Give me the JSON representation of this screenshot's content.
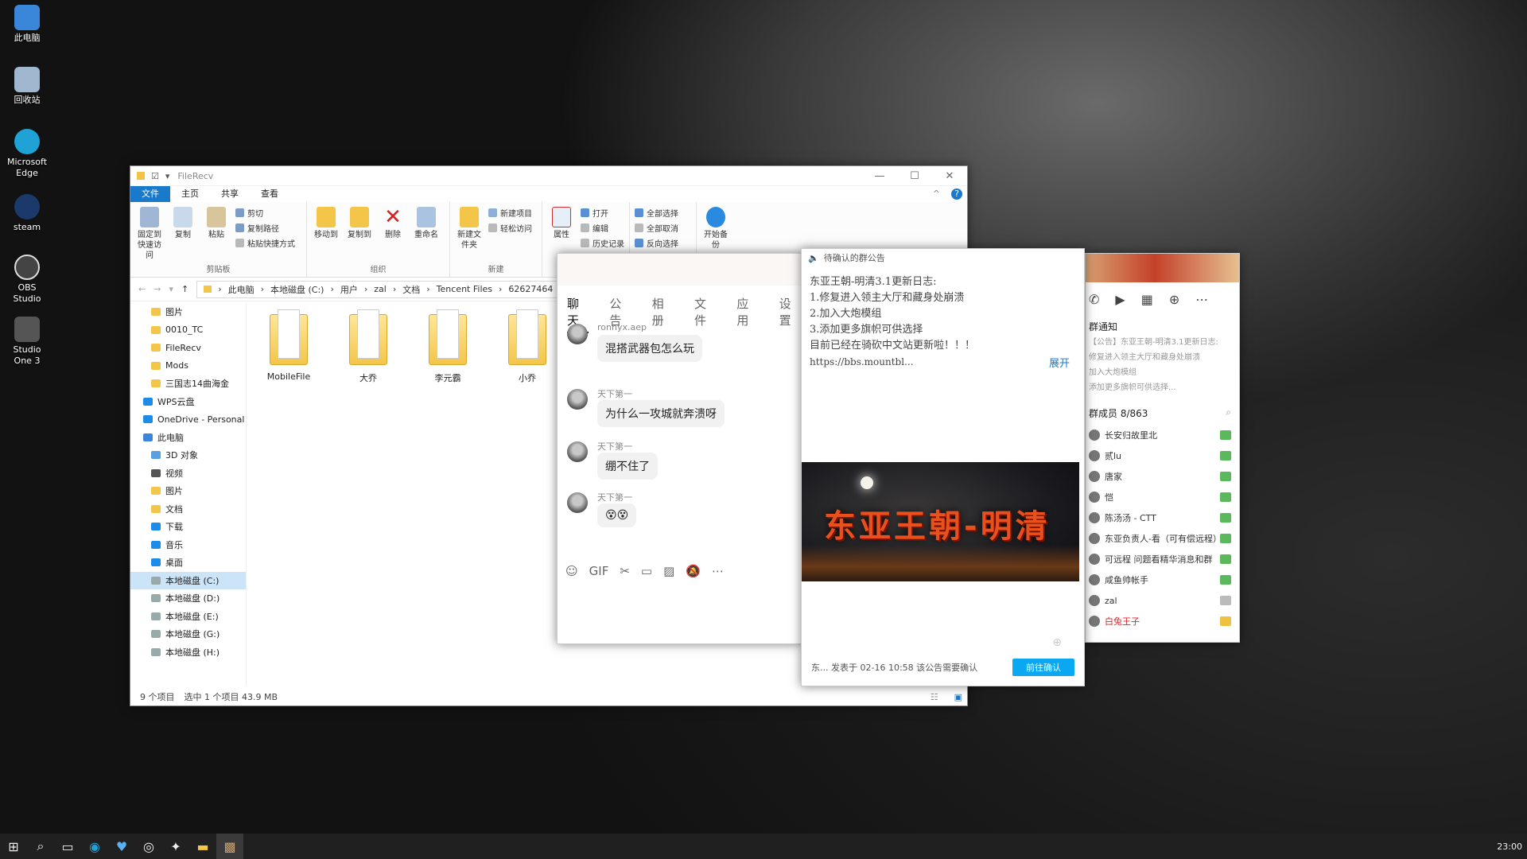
{
  "desktop": {
    "icons": [
      {
        "label": "此电脑",
        "color": "#3a86d8"
      },
      {
        "label": "回收站",
        "color": "#9fb8d0"
      },
      {
        "label": "Microsoft Edge",
        "color": "#1fa3d6"
      },
      {
        "label": "steam",
        "color": "#1b3a6b"
      },
      {
        "label": "OBS Studio",
        "color": "#444444"
      },
      {
        "label": "Studio One 3",
        "color": "#555555"
      }
    ]
  },
  "explorer": {
    "title": "FileRecv",
    "tabs": [
      "文件",
      "主页",
      "共享",
      "查看"
    ],
    "ribbon": {
      "clipboard": {
        "name": "剪贴板",
        "pin": "固定到快速访问",
        "copy": "复制",
        "paste": "粘贴",
        "cut": "剪切",
        "copy_path": "复制路径",
        "paste_shortcut": "粘贴快捷方式"
      },
      "organize": {
        "name": "组织",
        "move_to": "移动到",
        "copy_to": "复制到",
        "delete": "删除",
        "rename": "重命名"
      },
      "new": {
        "name": "新建",
        "new_folder": "新建文件夹",
        "new_item": "新建项目",
        "easy_access": "轻松访问"
      },
      "open": {
        "properties": "属性",
        "open": "打开",
        "edit": "编辑",
        "history": "历史记录"
      },
      "select": {
        "all": "全部选择",
        "none": "全部取消",
        "invert": "反向选择"
      },
      "sync": "开始备份"
    },
    "breadcrumbs": [
      "此电脑",
      "本地磁盘 (C:)",
      "用户",
      "zal",
      "文档",
      "Tencent Files",
      "62627464"
    ],
    "nav": [
      "图片",
      "0010_TC",
      "FileRecv",
      "Mods",
      "三国志14曲海金",
      "WPS云盘",
      "OneDrive - Personal",
      "此电脑",
      "3D 对象",
      "视频",
      "图片",
      "文档",
      "下载",
      "音乐",
      "桌面",
      "本地磁盘 (C:)",
      "本地磁盘 (D:)",
      "本地磁盘 (E:)",
      "本地磁盘 (G:)",
      "本地磁盘 (H:)"
    ],
    "files": [
      "MobileFile",
      "大乔",
      "李元霸",
      "小乔"
    ],
    "status": {
      "count": "9 个项目",
      "selected": "选中 1 个项目  43.9 MB"
    }
  },
  "chat": {
    "tabs": [
      "聊天",
      "公告",
      "相册",
      "文件",
      "应用",
      "设置"
    ],
    "messages": [
      {
        "name": "ronnyx.aep",
        "text": "混搭武器包怎么玩"
      },
      {
        "name": "天下第一",
        "text": "为什么一攻城就奔溃呀"
      },
      {
        "name": "天下第一",
        "text": "绷不住了"
      },
      {
        "name": "天下第一",
        "text": "😵😵"
      }
    ],
    "tools": [
      "☺",
      "GIF",
      "✂",
      "▭",
      "▨",
      "🔕",
      "⋯"
    ]
  },
  "notice": {
    "header": "待确认的群公告",
    "lines": [
      "东亚王朝-明清3.1更新日志:",
      "1.修复进入领主大厅和藏身处崩溃",
      "2.加入大炮模组",
      "3.添加更多旗帜可供选择",
      "目前已经在骑砍中文站更新啦！！！"
    ],
    "link": "https://bbs.mountbl...",
    "expand": "展开",
    "banner_title": "东亚王朝-明清",
    "foot": "东...  发表于 02-16 10:58  该公告需要确认",
    "confirm": "前往确认"
  },
  "side": {
    "section_notice": "群通知",
    "notice_preview": [
      "【公告】东亚王朝-明清3.1更新日志:",
      "修复进入领主大厅和藏身处崩溃",
      "加入大炮模组",
      "添加更多旗帜可供选择..."
    ],
    "members_title": "群成员 8/863",
    "members": [
      "长安归故里北",
      "贰lu",
      "唐家",
      "恺",
      "陈汤汤 - CTT",
      "东亚负责人-看（可有偿远程）",
      "可远程  问题看精华消息和群",
      "咸鱼帅帐手",
      "zal",
      "白兔王子"
    ]
  },
  "taskbar": {
    "clock": "23:00"
  }
}
